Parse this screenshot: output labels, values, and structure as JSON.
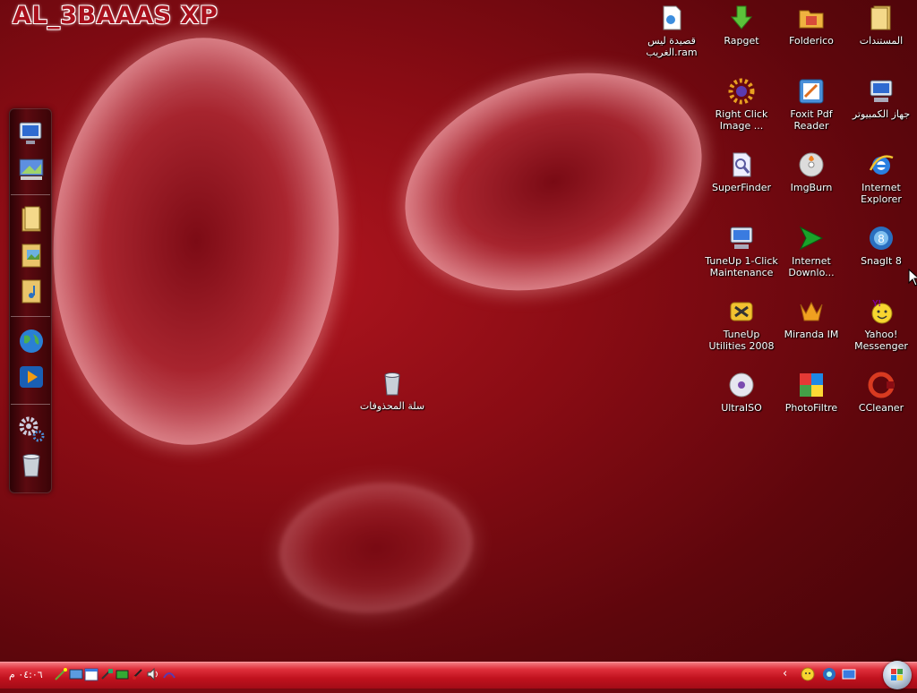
{
  "wallpaper_title": "AL_3BAAAS XP",
  "colors": {
    "accent": "#b0151f",
    "taskbar": "#c1121e"
  },
  "dock": {
    "items": [
      {
        "name": "my-computer-icon"
      },
      {
        "name": "desktop-icon"
      },
      {
        "name": "documents-icon"
      },
      {
        "name": "pictures-icon"
      },
      {
        "name": "music-icon"
      },
      {
        "name": "internet-globe-icon"
      },
      {
        "name": "media-player-icon"
      },
      {
        "name": "settings-gears-icon"
      },
      {
        "name": "recycle-bin-icon"
      }
    ]
  },
  "desktop": {
    "icons": [
      {
        "label": "قصيدة ليس الغريب.ram",
        "icon": "document-icon"
      },
      {
        "label": "Rapget",
        "icon": "download-arrow-icon"
      },
      {
        "label": "Folderico",
        "icon": "folder-icon"
      },
      {
        "label": "المستندات",
        "icon": "my-documents-icon"
      },
      {
        "label": "Right Click Image ...",
        "icon": "sun-gear-icon"
      },
      {
        "label": "Foxit Pdf Reader",
        "icon": "pdf-reader-icon"
      },
      {
        "label": "جهاز الكمبيوتر",
        "icon": "computer-icon"
      },
      {
        "label": "SuperFinder",
        "icon": "magnifier-document-icon"
      },
      {
        "label": "ImgBurn",
        "icon": "disc-burn-icon"
      },
      {
        "label": "Internet Explorer",
        "icon": "internet-explorer-icon"
      },
      {
        "label": "TuneUp 1-Click Maintenance",
        "icon": "computer-maintenance-icon"
      },
      {
        "label": "Internet Downlo...",
        "icon": "download-manager-icon"
      },
      {
        "label": "SnagIt 8",
        "icon": "snagit-icon"
      },
      {
        "label": "TuneUp Utilities 2008",
        "icon": "tools-icon"
      },
      {
        "label": "Miranda IM",
        "icon": "miranda-icon"
      },
      {
        "label": "Yahoo! Messenger",
        "icon": "yahoo-messenger-icon"
      },
      {
        "label": "UltraISO",
        "icon": "cd-icon"
      },
      {
        "label": "PhotoFiltre",
        "icon": "palette-icon"
      },
      {
        "label": "CCleaner",
        "icon": "ccleaner-icon"
      },
      {
        "label": "سلة المحذوفات",
        "icon": "recycle-bin-icon"
      }
    ]
  },
  "taskbar": {
    "clock": "٠٤:٠٦ م",
    "tray_chevron": "‹"
  }
}
